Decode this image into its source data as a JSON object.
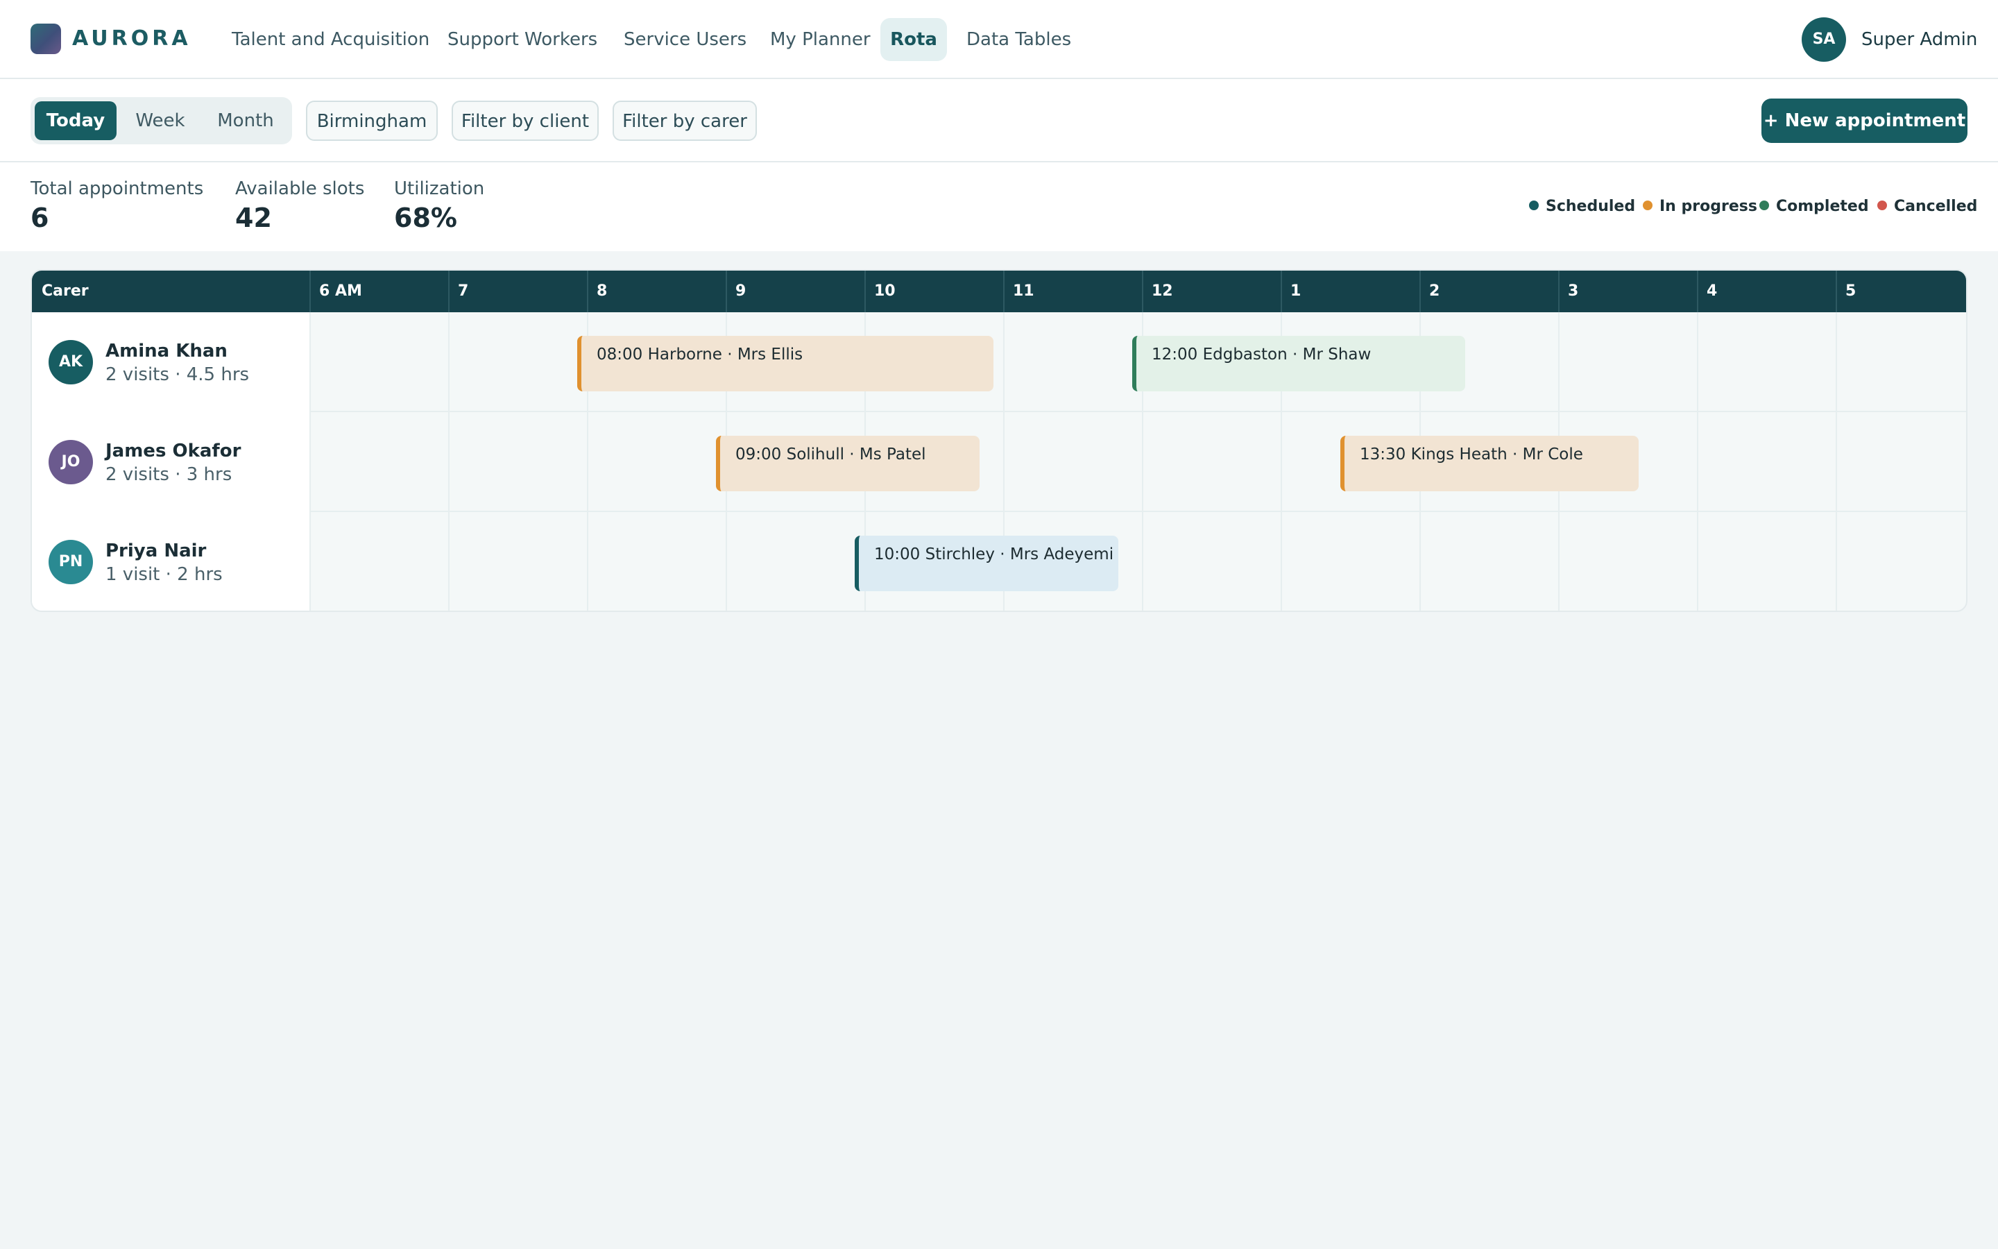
{
  "app": {
    "brand": "AURORA"
  },
  "nav": {
    "items": [
      {
        "label": "Talent and Acquisition"
      },
      {
        "label": "Support Workers"
      },
      {
        "label": "Service Users"
      },
      {
        "label": "My Planner"
      },
      {
        "label": "Rota",
        "active": true
      },
      {
        "label": "Data Tables"
      }
    ]
  },
  "user": {
    "initials": "SA",
    "name": "Super Admin"
  },
  "toolbar": {
    "views": [
      {
        "label": "Today",
        "active": true
      },
      {
        "label": "Week"
      },
      {
        "label": "Month"
      }
    ],
    "location": "Birmingham",
    "filter_client": "Filter by client",
    "filter_carer": "Filter by carer",
    "new_appointment": "+ New appointment"
  },
  "stats": {
    "total_label": "Total appointments",
    "total_value": "6",
    "slots_label": "Available slots",
    "slots_value": "42",
    "util_label": "Utilization",
    "util_value": "68%"
  },
  "legend": [
    {
      "label": "Scheduled",
      "color": "#175d62"
    },
    {
      "label": "In progress",
      "color": "#e0912f"
    },
    {
      "label": "Completed",
      "color": "#2f7d5a"
    },
    {
      "label": "Cancelled",
      "color": "#d2574d"
    }
  ],
  "rota": {
    "carer_header": "Carer",
    "hours": [
      "6 AM",
      "7",
      "8",
      "9",
      "10",
      "11",
      "12",
      "1",
      "2",
      "3",
      "4",
      "5"
    ],
    "carers": [
      {
        "initials": "AK",
        "name": "Amina Khan",
        "meta": "2 visits · 4.5 hrs",
        "avatar_color": "#175d62",
        "appointments": [
          {
            "label": "08:00 Harborne · Mrs Ellis",
            "status": "in-progress"
          },
          {
            "label": "12:00 Edgbaston · Mr Shaw",
            "status": "completed"
          }
        ]
      },
      {
        "initials": "JO",
        "name": "James Okafor",
        "meta": "2 visits · 3 hrs",
        "avatar_color": "#6b5a8e",
        "appointments": [
          {
            "label": "09:00 Solihull · Ms Patel",
            "status": "in-progress"
          },
          {
            "label": "13:30 Kings Heath · Mr Cole",
            "status": "in-progress"
          }
        ]
      },
      {
        "initials": "PN",
        "name": "Priya Nair",
        "meta": "1 visit · 2 hrs",
        "avatar_color": "#2a8a92",
        "appointments": [
          {
            "label": "10:00 Stirchley · Mrs Adeyemi",
            "status": "scheduled"
          }
        ]
      }
    ]
  }
}
